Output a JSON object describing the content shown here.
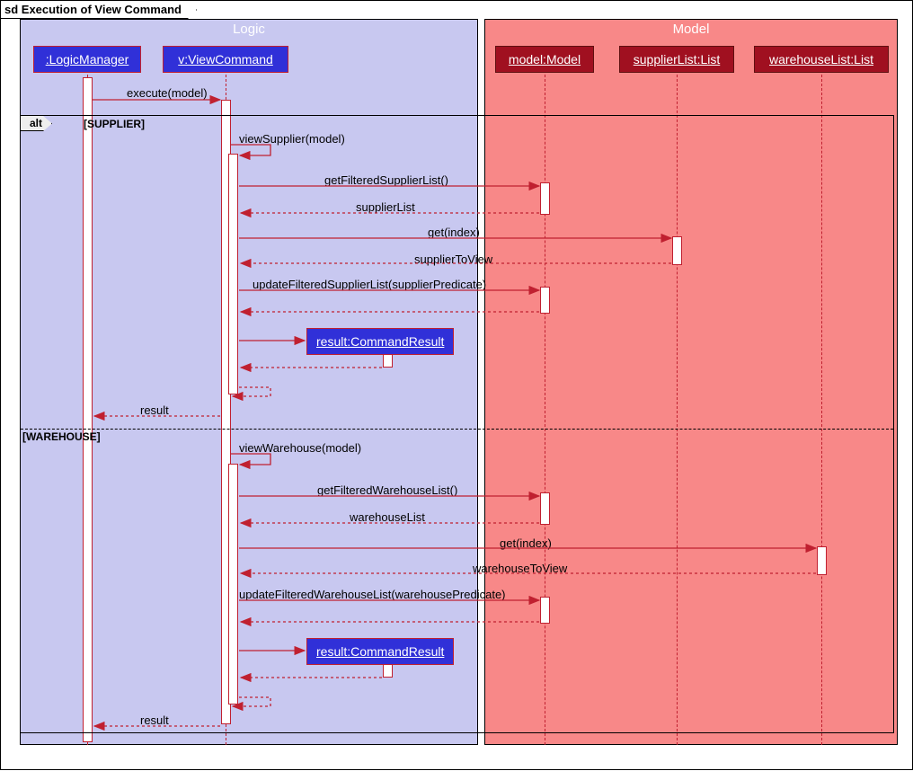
{
  "frame_title": "sd Execution of View Command",
  "packages": {
    "logic": "Logic",
    "model": "Model"
  },
  "participants": {
    "logicManager": ":LogicManager",
    "viewCommand": "v:ViewCommand",
    "model": "model:Model",
    "supplierList": "supplierList:List",
    "warehouseList": "warehouseList:List"
  },
  "created": {
    "result1": "result:CommandResult",
    "result2": "result:CommandResult"
  },
  "alt": {
    "label": "alt",
    "guard1": "[SUPPLIER]",
    "guard2": "[WAREHOUSE]"
  },
  "messages": {
    "execute": "execute(model)",
    "viewSupplier": "viewSupplier(model)",
    "getFilteredSupplierList": "getFilteredSupplierList()",
    "supplierList_ret": "supplierList",
    "get_index1": "get(index)",
    "supplierToView": "supplierToView",
    "updateFilteredSupplier": "updateFilteredSupplierList(supplierPredicate)",
    "result_ret1": "result",
    "viewWarehouse": "viewWarehouse(model)",
    "getFilteredWarehouseList": "getFilteredWarehouseList()",
    "warehouseList_ret": "warehouseList",
    "get_index2": "get(index)",
    "warehouseToView": "warehouseToView",
    "updateFilteredWarehouse": "updateFilteredWarehouseList(warehousePredicate)",
    "result_ret2": "result"
  },
  "chart_data": {
    "type": "sequence_diagram",
    "frame": "sd Execution of View Command",
    "packages": [
      {
        "name": "Logic",
        "participants": [
          ":LogicManager",
          "v:ViewCommand"
        ]
      },
      {
        "name": "Model",
        "participants": [
          "model:Model",
          "supplierList:List",
          "warehouseList:List"
        ]
      }
    ],
    "interactions": [
      {
        "from": ":LogicManager",
        "to": "v:ViewCommand",
        "label": "execute(model)",
        "type": "sync"
      },
      {
        "fragment": "alt",
        "guards": [
          "SUPPLIER",
          "WAREHOUSE"
        ],
        "branches": [
          [
            {
              "from": "v:ViewCommand",
              "to": "v:ViewCommand",
              "label": "viewSupplier(model)",
              "type": "self"
            },
            {
              "from": "v:ViewCommand",
              "to": "model:Model",
              "label": "getFilteredSupplierList()",
              "type": "sync"
            },
            {
              "from": "model:Model",
              "to": "v:ViewCommand",
              "label": "supplierList",
              "type": "return"
            },
            {
              "from": "v:ViewCommand",
              "to": "supplierList:List",
              "label": "get(index)",
              "type": "sync"
            },
            {
              "from": "supplierList:List",
              "to": "v:ViewCommand",
              "label": "supplierToView",
              "type": "return"
            },
            {
              "from": "v:ViewCommand",
              "to": "model:Model",
              "label": "updateFilteredSupplierList(supplierPredicate)",
              "type": "sync"
            },
            {
              "from": "model:Model",
              "to": "v:ViewCommand",
              "label": "",
              "type": "return"
            },
            {
              "from": "v:ViewCommand",
              "to": "result:CommandResult",
              "label": "",
              "type": "create"
            },
            {
              "from": "result:CommandResult",
              "to": "v:ViewCommand",
              "label": "",
              "type": "return"
            },
            {
              "from": "v:ViewCommand",
              "to": "v:ViewCommand",
              "label": "",
              "type": "self-return"
            },
            {
              "from": "v:ViewCommand",
              "to": ":LogicManager",
              "label": "result",
              "type": "return"
            }
          ],
          [
            {
              "from": "v:ViewCommand",
              "to": "v:ViewCommand",
              "label": "viewWarehouse(model)",
              "type": "self"
            },
            {
              "from": "v:ViewCommand",
              "to": "model:Model",
              "label": "getFilteredWarehouseList()",
              "type": "sync"
            },
            {
              "from": "model:Model",
              "to": "v:ViewCommand",
              "label": "warehouseList",
              "type": "return"
            },
            {
              "from": "v:ViewCommand",
              "to": "warehouseList:List",
              "label": "get(index)",
              "type": "sync"
            },
            {
              "from": "warehouseList:List",
              "to": "v:ViewCommand",
              "label": "warehouseToView",
              "type": "return"
            },
            {
              "from": "v:ViewCommand",
              "to": "model:Model",
              "label": "updateFilteredWarehouseList(warehousePredicate)",
              "type": "sync"
            },
            {
              "from": "model:Model",
              "to": "v:ViewCommand",
              "label": "",
              "type": "return"
            },
            {
              "from": "v:ViewCommand",
              "to": "result:CommandResult",
              "label": "",
              "type": "create"
            },
            {
              "from": "result:CommandResult",
              "to": "v:ViewCommand",
              "label": "",
              "type": "return"
            },
            {
              "from": "v:ViewCommand",
              "to": "v:ViewCommand",
              "label": "",
              "type": "self-return"
            },
            {
              "from": "v:ViewCommand",
              "to": ":LogicManager",
              "label": "result",
              "type": "return"
            }
          ]
        ]
      }
    ]
  }
}
